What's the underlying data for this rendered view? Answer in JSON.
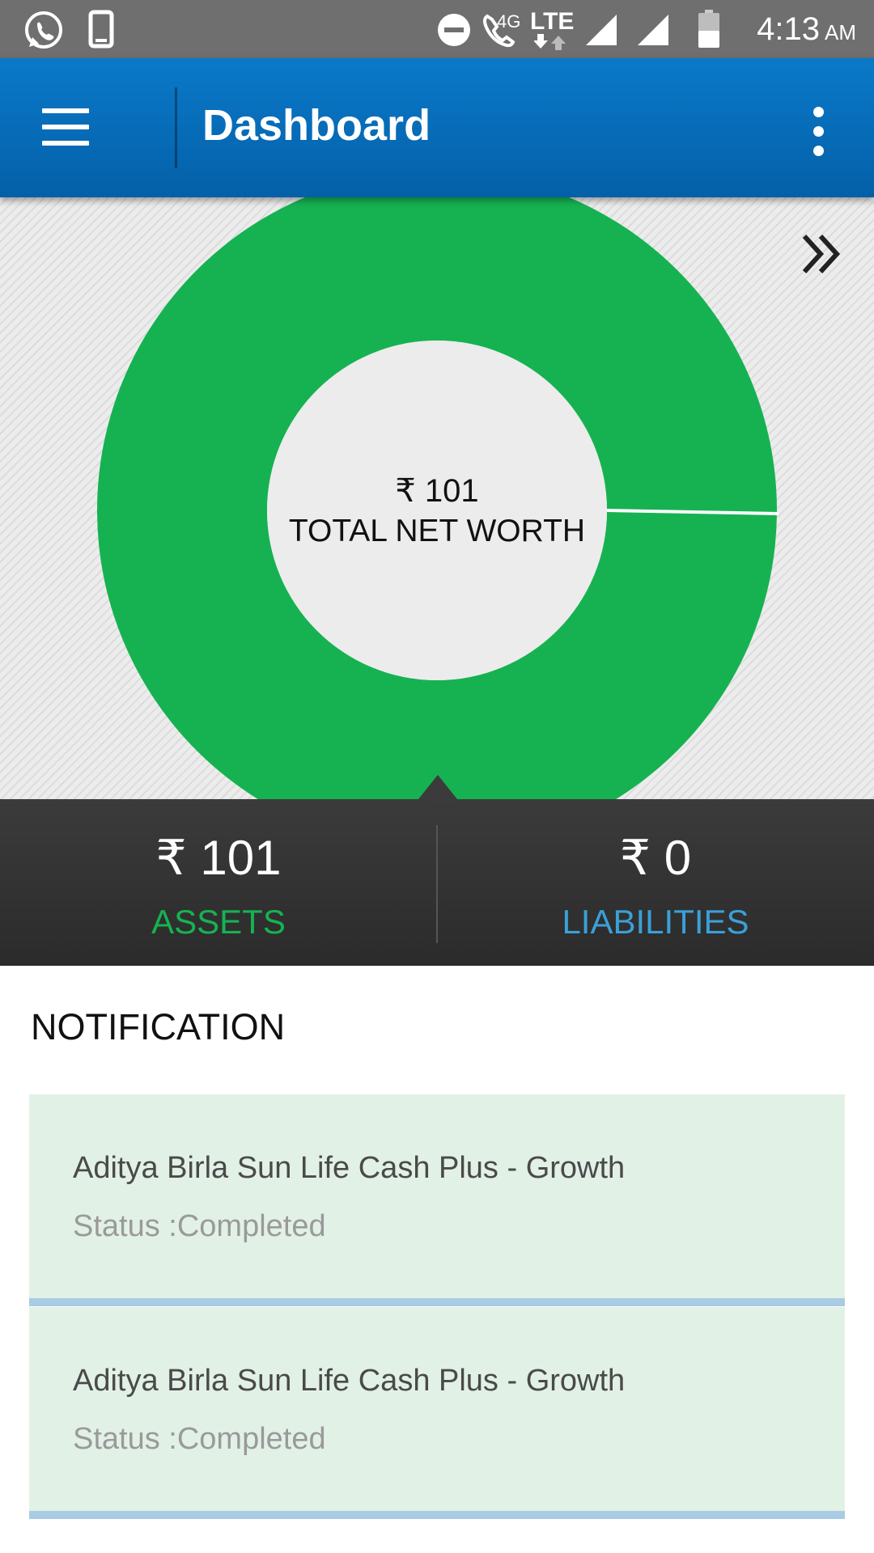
{
  "status_bar": {
    "time": "4:13",
    "ampm": "AM",
    "network_label_4g": "4G",
    "network_label_lte": "LTE",
    "icons": [
      "whatsapp-icon",
      "phone-outline-icon",
      "do-not-disturb-icon",
      "wifi-call-icon",
      "lte-data-icon",
      "signal-icon",
      "signal-icon",
      "battery-icon"
    ]
  },
  "app_bar": {
    "title": "Dashboard",
    "icons": [
      "hamburger-menu-icon",
      "overflow-menu-icon"
    ]
  },
  "chart": {
    "expand_icon": "double-chevron-right-icon",
    "center_value": "₹ 101",
    "center_caption": "TOTAL NET WORTH"
  },
  "chart_data": {
    "type": "pie",
    "categories": [
      "Assets",
      "Liabilities"
    ],
    "values": [
      101,
      0
    ],
    "colors": [
      "#16b251",
      "#3aa0d8"
    ]
  },
  "summary": {
    "assets_value": "₹ 101",
    "assets_label": "ASSETS",
    "assets_color": "#16b251",
    "liabilities_value": "₹ 0",
    "liabilities_label": "LIABILITIES",
    "liabilities_color": "#3aa0d8"
  },
  "notification": {
    "heading": "NOTIFICATION",
    "items": [
      {
        "title": "Aditya Birla Sun Life Cash Plus - Growth",
        "status": "Status :Completed"
      },
      {
        "title": "Aditya Birla Sun Life Cash Plus - Growth",
        "status": "Status :Completed"
      }
    ]
  }
}
